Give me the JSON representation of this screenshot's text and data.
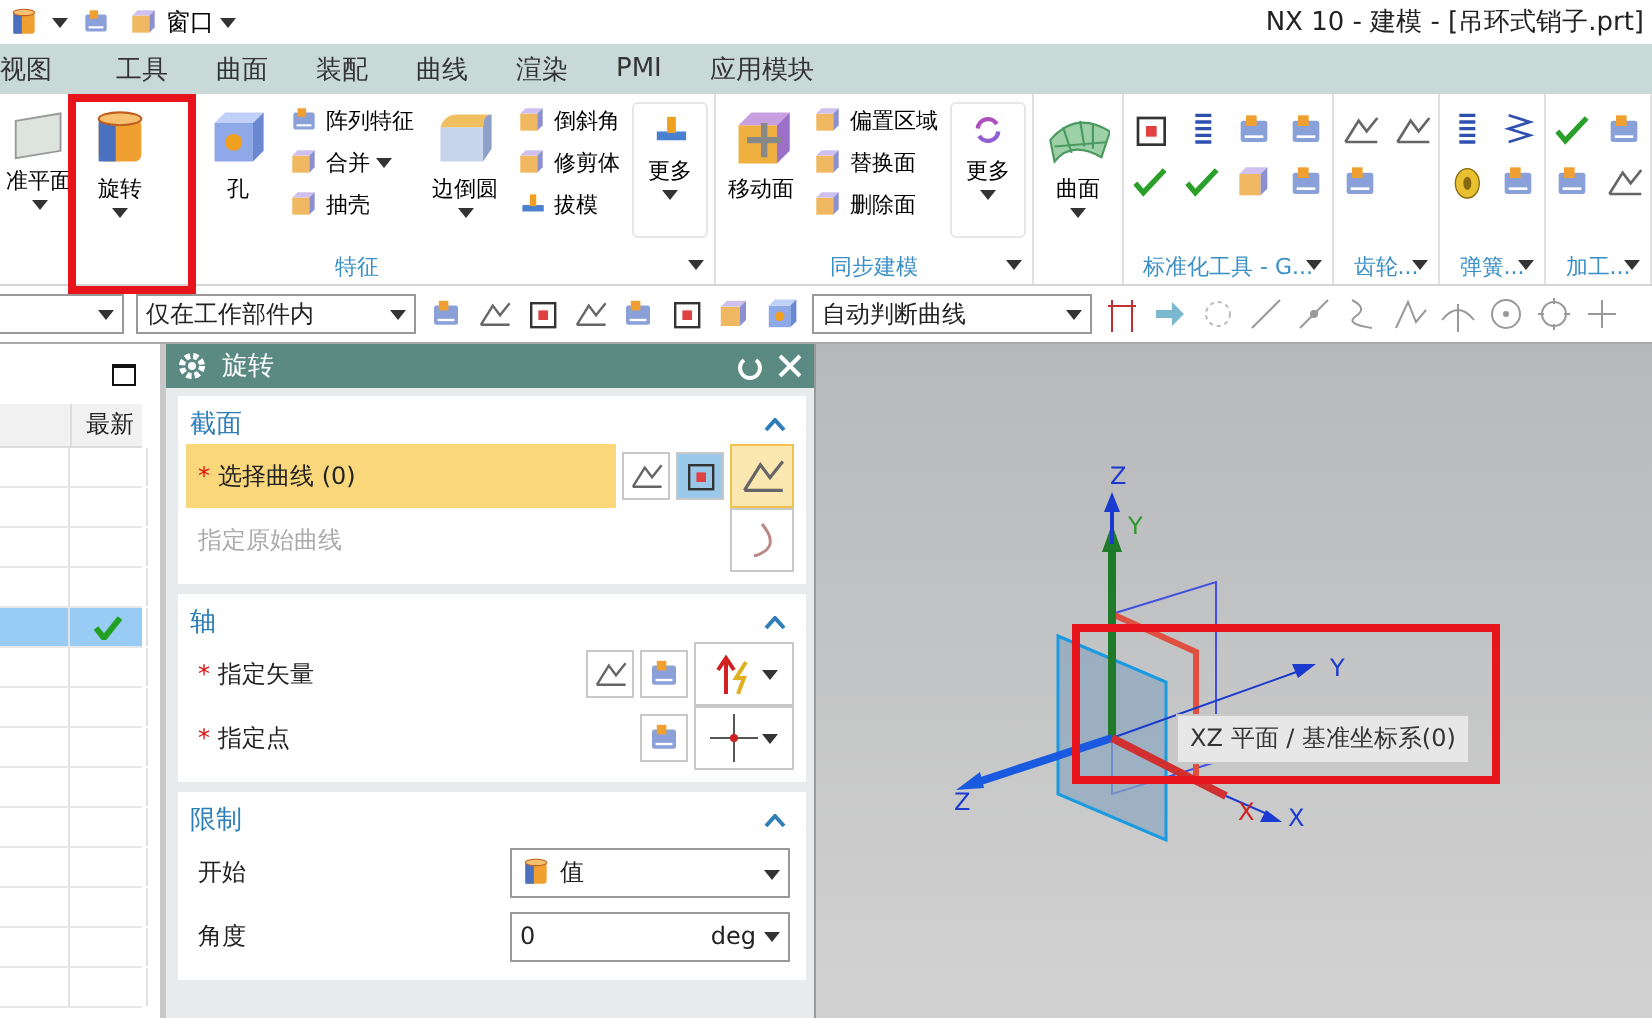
{
  "title_bar": {
    "menu": "窗口",
    "title": "NX 10 - 建模 - [吊环式销子.prt]"
  },
  "tabs": [
    {
      "label": "视图"
    },
    {
      "label": "工具"
    },
    {
      "label": "曲面"
    },
    {
      "label": "装配"
    },
    {
      "label": "曲线"
    },
    {
      "label": "渲染"
    },
    {
      "label": "PMI"
    },
    {
      "label": "应用模块"
    }
  ],
  "ribbon": {
    "groups": [
      {
        "kind": "buttons",
        "label": "特征",
        "items": [
          {
            "kind": "large",
            "label": "准平面",
            "caret": true
          },
          {
            "kind": "large",
            "label": "旋转",
            "caret": true
          },
          {
            "kind": "large",
            "label": "孔",
            "caret": false
          },
          {
            "kind": "stack",
            "entries": [
              {
                "label": "阵列特征",
                "caret": false
              },
              {
                "label": "合并",
                "caret": true
              },
              {
                "label": "抽壳",
                "caret": false
              }
            ]
          },
          {
            "kind": "large",
            "label": "边倒圆",
            "caret": true
          },
          {
            "kind": "stack",
            "entries": [
              {
                "label": "倒斜角",
                "caret": false
              },
              {
                "label": "修剪体",
                "caret": false
              },
              {
                "label": "拔模",
                "caret": false
              }
            ]
          },
          {
            "kind": "more",
            "label": "更多",
            "caret": true
          }
        ]
      },
      {
        "kind": "buttons",
        "label": "同步建模",
        "items": [
          {
            "kind": "large",
            "label": "移动面",
            "caret": false
          },
          {
            "kind": "stack",
            "entries": [
              {
                "label": "偏置区域",
                "caret": false
              },
              {
                "label": "替换面",
                "caret": false
              },
              {
                "label": "删除面",
                "caret": false
              }
            ]
          },
          {
            "kind": "more",
            "label": "更多",
            "caret": true
          }
        ]
      },
      {
        "kind": "buttons",
        "items": [
          {
            "kind": "large",
            "label": "曲面",
            "caret": true
          }
        ]
      },
      {
        "kind": "icons",
        "label": "标准化工具 - G..."
      },
      {
        "kind": "icons",
        "label": "齿轮..."
      },
      {
        "kind": "icons",
        "label": "弹簧..."
      },
      {
        "kind": "icons",
        "label": "加工..."
      }
    ]
  },
  "selection_bar": {
    "scope": "仅在工作部件内",
    "curve_rule": "自动判断曲线"
  },
  "navigator": {
    "columns": [
      {
        "label": "最新"
      }
    ],
    "rows": [
      {
        "selected": false,
        "latest": false
      },
      {
        "selected": false,
        "latest": false
      },
      {
        "selected": false,
        "latest": false
      },
      {
        "selected": false,
        "latest": false
      },
      {
        "selected": true,
        "latest": true
      },
      {
        "selected": false,
        "latest": false
      },
      {
        "selected": false,
        "latest": false
      },
      {
        "selected": false,
        "latest": false
      },
      {
        "selected": false,
        "latest": false
      },
      {
        "selected": false,
        "latest": false
      },
      {
        "selected": false,
        "latest": false
      },
      {
        "selected": false,
        "latest": false
      },
      {
        "selected": false,
        "latest": false
      },
      {
        "selected": false,
        "latest": false
      }
    ]
  },
  "dialog": {
    "title": "旋转",
    "sections": [
      {
        "title": "截面",
        "expanded": true,
        "rows": [
          {
            "kind": "select",
            "label": "选择曲线 (0)",
            "marker": "*",
            "active": true
          },
          {
            "kind": "hint",
            "label": "指定原始曲线",
            "disabled": true
          }
        ]
      },
      {
        "title": "轴",
        "expanded": true,
        "rows": [
          {
            "kind": "vector",
            "label": "指定矢量",
            "marker": "*",
            "active": false
          },
          {
            "kind": "point",
            "label": "指定点",
            "marker": "*",
            "active": false
          }
        ]
      },
      {
        "title": "限制",
        "expanded": true,
        "rows": [
          {
            "kind": "dropdown",
            "label": "开始",
            "value": "值"
          },
          {
            "kind": "number",
            "label": "角度",
            "value": "0",
            "unit": "deg"
          }
        ]
      }
    ]
  },
  "viewport": {
    "axis_labels": [
      "Z",
      "Y",
      "Y",
      "Z",
      "X",
      "X"
    ],
    "tooltip": "XZ 平面 / 基准坐标系(0)"
  }
}
